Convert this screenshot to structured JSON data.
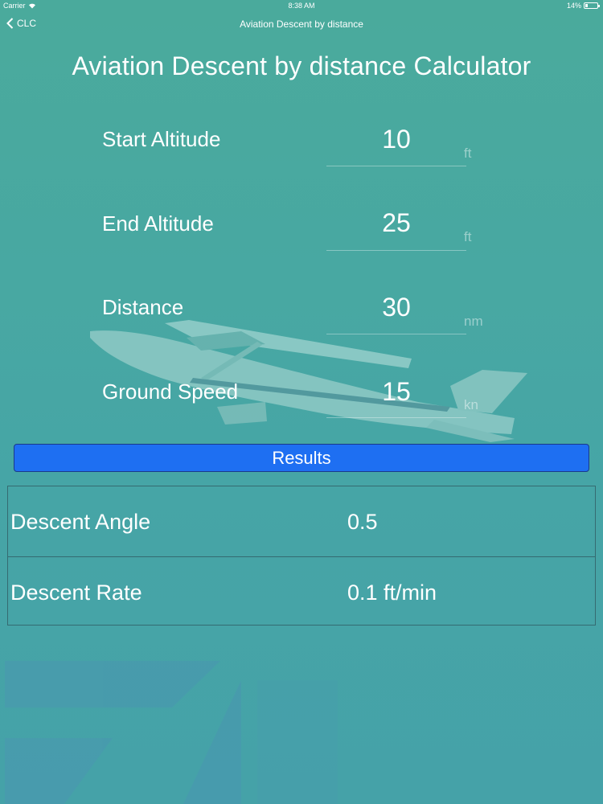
{
  "status_bar": {
    "carrier": "Carrier",
    "time": "8:38 AM",
    "battery": "14%"
  },
  "nav": {
    "back_label": "CLC",
    "title": "Aviation Descent by distance"
  },
  "page_title": "Aviation Descent by distance Calculator",
  "fields": [
    {
      "label": "Start Altitude",
      "value": "10",
      "unit": "ft"
    },
    {
      "label": "End Altitude",
      "value": "25",
      "unit": "ft"
    },
    {
      "label": "Distance",
      "value": "30",
      "unit": "nm"
    },
    {
      "label": "Ground Speed",
      "value": "15",
      "unit": "kn"
    }
  ],
  "results_button": "Results",
  "results": [
    {
      "label": "Descent Angle",
      "value": "0.5"
    },
    {
      "label": "Descent Rate",
      "value": "0.1 ft/min"
    }
  ],
  "colors": {
    "background": "#46a5a6",
    "button": "#1e6ff2"
  }
}
